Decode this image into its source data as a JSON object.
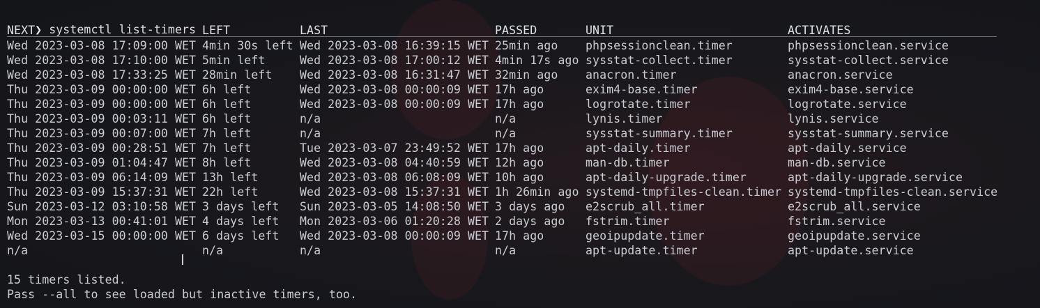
{
  "terminal": {
    "prompt_symbol": "❯",
    "command": "systemctl list-timers",
    "cursor_glyph": "I",
    "headers": {
      "next": "NEXT",
      "left": "LEFT",
      "last": "LAST",
      "passed": "PASSED",
      "unit": "UNIT",
      "activates": "ACTIVATES"
    },
    "rows": [
      {
        "next": "Wed 2023-03-08 17:09:00 WET",
        "left": "4min 30s left",
        "last": "Wed 2023-03-08 16:39:15 WET",
        "passed": "25min ago",
        "unit": "phpsessionclean.timer",
        "activates": "phpsessionclean.service"
      },
      {
        "next": "Wed 2023-03-08 17:10:00 WET",
        "left": "5min left",
        "last": "Wed 2023-03-08 17:00:12 WET",
        "passed": "4min 17s ago",
        "unit": "sysstat-collect.timer",
        "activates": "sysstat-collect.service"
      },
      {
        "next": "Wed 2023-03-08 17:33:25 WET",
        "left": "28min left",
        "last": "Wed 2023-03-08 16:31:47 WET",
        "passed": "32min ago",
        "unit": "anacron.timer",
        "activates": "anacron.service"
      },
      {
        "next": "Thu 2023-03-09 00:00:00 WET",
        "left": "6h left",
        "last": "Wed 2023-03-08 00:00:09 WET",
        "passed": "17h ago",
        "unit": "exim4-base.timer",
        "activates": "exim4-base.service"
      },
      {
        "next": "Thu 2023-03-09 00:00:00 WET",
        "left": "6h left",
        "last": "Wed 2023-03-08 00:00:09 WET",
        "passed": "17h ago",
        "unit": "logrotate.timer",
        "activates": "logrotate.service"
      },
      {
        "next": "Thu 2023-03-09 00:03:11 WET",
        "left": "6h left",
        "last": "n/a",
        "passed": "n/a",
        "unit": "lynis.timer",
        "activates": "lynis.service"
      },
      {
        "next": "Thu 2023-03-09 00:07:00 WET",
        "left": "7h left",
        "last": "n/a",
        "passed": "n/a",
        "unit": "sysstat-summary.timer",
        "activates": "sysstat-summary.service"
      },
      {
        "next": "Thu 2023-03-09 00:28:51 WET",
        "left": "7h left",
        "last": "Tue 2023-03-07 23:49:52 WET",
        "passed": "17h ago",
        "unit": "apt-daily.timer",
        "activates": "apt-daily.service"
      },
      {
        "next": "Thu 2023-03-09 01:04:47 WET",
        "left": "8h left",
        "last": "Wed 2023-03-08 04:40:59 WET",
        "passed": "12h ago",
        "unit": "man-db.timer",
        "activates": "man-db.service"
      },
      {
        "next": "Thu 2023-03-09 06:14:09 WET",
        "left": "13h left",
        "last": "Wed 2023-03-08 06:08:09 WET",
        "passed": "10h ago",
        "unit": "apt-daily-upgrade.timer",
        "activates": "apt-daily-upgrade.service"
      },
      {
        "next": "Thu 2023-03-09 15:37:31 WET",
        "left": "22h left",
        "last": "Wed 2023-03-08 15:37:31 WET",
        "passed": "1h 26min ago",
        "unit": "systemd-tmpfiles-clean.timer",
        "activates": "systemd-tmpfiles-clean.service"
      },
      {
        "next": "Sun 2023-03-12 03:10:58 WET",
        "left": "3 days left",
        "last": "Sun 2023-03-05 14:08:50 WET",
        "passed": "3 days ago",
        "unit": "e2scrub_all.timer",
        "activates": "e2scrub_all.service"
      },
      {
        "next": "Mon 2023-03-13 00:41:01 WET",
        "left": "4 days left",
        "last": "Mon 2023-03-06 01:20:28 WET",
        "passed": "2 days ago",
        "unit": "fstrim.timer",
        "activates": "fstrim.service"
      },
      {
        "next": "Wed 2023-03-15 00:00:00 WET",
        "left": "6 days left",
        "last": "Wed 2023-03-08 00:00:09 WET",
        "passed": "17h ago",
        "unit": "geoipupdate.timer",
        "activates": "geoipupdate.service"
      },
      {
        "next": "n/a",
        "left": "n/a",
        "last": "n/a",
        "passed": "n/a",
        "unit": "apt-update.timer",
        "activates": "apt-update.service"
      }
    ],
    "summary": "15 timers listed.",
    "hint": "Pass --all to see loaded but inactive timers, too.",
    "colors": {
      "background": "#15161b",
      "text": "#c9cdd3",
      "prompt": "#e8e8e8"
    }
  }
}
